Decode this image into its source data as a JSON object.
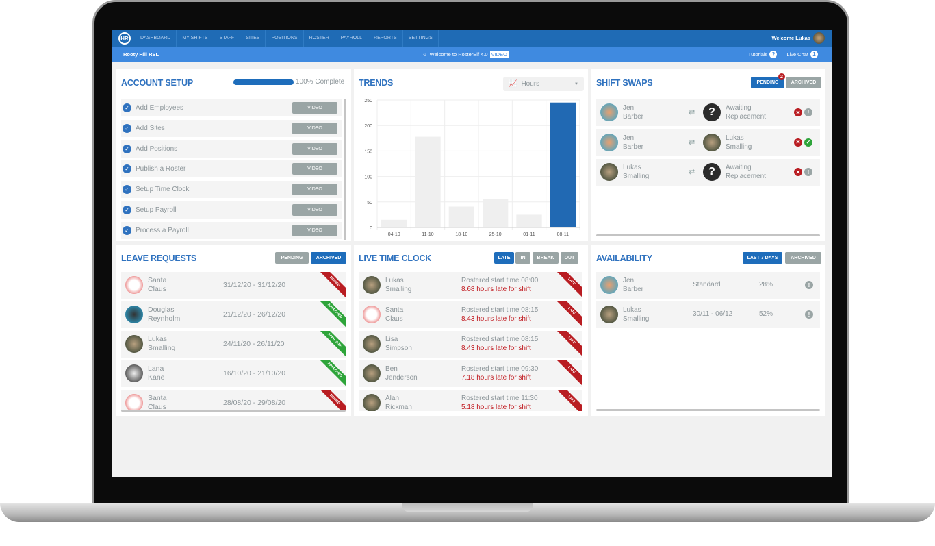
{
  "nav": {
    "items": [
      "DASHBOARD",
      "MY SHIFTS",
      "STAFF",
      "SITES",
      "POSITIONS",
      "ROSTER",
      "PAYROLL",
      "REPORTS",
      "SETTINGS"
    ],
    "welcome": "Welcome Lukas",
    "logo": "HR"
  },
  "subbar": {
    "site": "Rooty Hill RSL",
    "welcome": "Welcome to RosterElf 4.0",
    "video": "VIDEO",
    "tutorials": "Tutorials",
    "tutorials_icon": "?",
    "live_chat": "Live Chat",
    "live_chat_count": "1"
  },
  "account_setup": {
    "title": "ACCOUNT SETUP",
    "progress": 100,
    "progress_label": "100% Complete",
    "video_label": "VIDEO",
    "items": [
      "Add Employees",
      "Add Sites",
      "Add Positions",
      "Publish a Roster",
      "Setup Time Clock",
      "Setup Payroll",
      "Process a Payroll"
    ]
  },
  "trends": {
    "title": "TRENDS",
    "select": "Hours"
  },
  "chart_data": {
    "type": "bar",
    "categories": [
      "04-10",
      "11-10",
      "18-10",
      "25-10",
      "01-11",
      "08-11"
    ],
    "values": [
      15,
      178,
      41,
      56,
      25,
      245
    ],
    "ylim": [
      0,
      250
    ],
    "yticks": [
      0,
      50,
      100,
      150,
      200,
      250
    ],
    "grid": true,
    "highlight": "08-11",
    "colors": {
      "default": "#efefef",
      "highlight": "#2169b3"
    }
  },
  "shift_swaps": {
    "title": "SHIFT SWAPS",
    "pending": "PENDING",
    "pending_count": "2",
    "archived": "ARCHIVED",
    "rows": [
      {
        "from": [
          "Jen",
          "Barber"
        ],
        "to": [
          "Awaiting",
          "Replacement"
        ],
        "to_known": false,
        "status": "pending"
      },
      {
        "from": [
          "Jen",
          "Barber"
        ],
        "to": [
          "Lukas",
          "Smalling"
        ],
        "to_known": true,
        "status": "accepted"
      },
      {
        "from": [
          "Lukas",
          "Smalling"
        ],
        "to": [
          "Awaiting",
          "Replacement"
        ],
        "to_known": false,
        "status": "pending"
      }
    ]
  },
  "leave_requests": {
    "title": "LEAVE REQUESTS",
    "pending": "PENDING",
    "archived": "ARCHIVED",
    "rows": [
      {
        "name": [
          "Santa",
          "Claus"
        ],
        "dates": "31/12/20 - 31/12/20",
        "status": "DENIED"
      },
      {
        "name": [
          "Douglas",
          "Reynholm"
        ],
        "dates": "21/12/20 - 26/12/20",
        "status": "APPROVED"
      },
      {
        "name": [
          "Lukas",
          "Smalling"
        ],
        "dates": "24/11/20 - 26/11/20",
        "status": "APPROVED"
      },
      {
        "name": [
          "Lana",
          "Kane"
        ],
        "dates": "16/10/20 - 21/10/20",
        "status": "APPROVED"
      },
      {
        "name": [
          "Santa",
          "Claus"
        ],
        "dates": "28/08/20 - 29/08/20",
        "status": "DENIED"
      }
    ]
  },
  "live_time_clock": {
    "title": "LIVE TIME CLOCK",
    "tabs": [
      "LATE",
      "IN",
      "BREAK",
      "OUT"
    ],
    "ribbon": "LATE",
    "rows": [
      {
        "name": [
          "Lukas",
          "Smalling"
        ],
        "start": "Rostered start time 08:00",
        "late": "8.68 hours late for shift"
      },
      {
        "name": [
          "Santa",
          "Claus"
        ],
        "start": "Rostered start time 08:15",
        "late": "8.43 hours late for shift"
      },
      {
        "name": [
          "Lisa",
          "Simpson"
        ],
        "start": "Rostered start time 08:15",
        "late": "8.43 hours late for shift"
      },
      {
        "name": [
          "Ben",
          "Jenderson"
        ],
        "start": "Rostered start time 09:30",
        "late": "7.18 hours late for shift"
      },
      {
        "name": [
          "Alan",
          "Rickman"
        ],
        "start": "Rostered start time 11:30",
        "late": "5.18 hours late for shift"
      }
    ]
  },
  "availability": {
    "title": "AVAILABILITY",
    "last7": "LAST 7 DAYS",
    "archived": "ARCHIVED",
    "rows": [
      {
        "name": [
          "Jen",
          "Barber"
        ],
        "period": "Standard",
        "pct": "28%"
      },
      {
        "name": [
          "Lukas",
          "Smalling"
        ],
        "period": "30/11 - 06/12",
        "pct": "52%"
      }
    ]
  }
}
